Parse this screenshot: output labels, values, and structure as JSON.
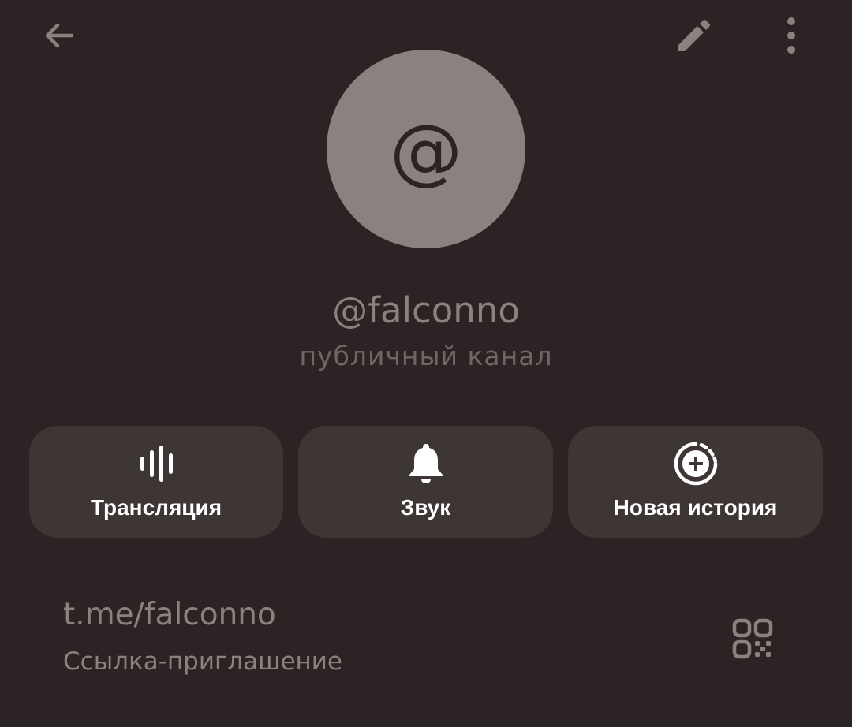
{
  "header": {
    "back_icon": "arrow-left-icon",
    "edit_icon": "pencil-icon",
    "more_icon": "more-vertical-icon"
  },
  "profile": {
    "avatar_glyph": "@",
    "name": "@falconno",
    "type": "публичный канал"
  },
  "actions": [
    {
      "label": "Трансляция",
      "icon": "live-stream-icon"
    },
    {
      "label": "Звук",
      "icon": "bell-icon"
    },
    {
      "label": "Новая история",
      "icon": "add-story-icon"
    }
  ],
  "link": {
    "url": "t.me/falconno",
    "caption": "Ссылка-приглашение",
    "qr_icon": "qr-code-icon"
  },
  "colors": {
    "background": "#2c2424",
    "muted": "#8b8280",
    "card": "#3e3634",
    "white": "#ffffff"
  }
}
